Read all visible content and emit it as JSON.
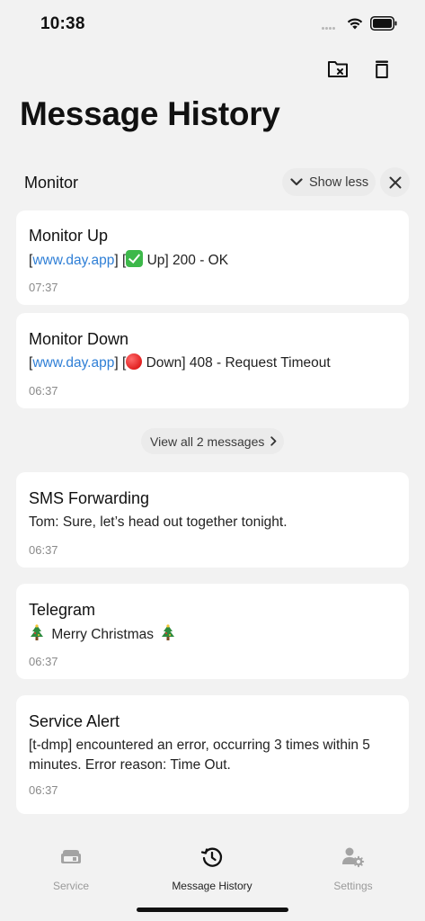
{
  "status_bar": {
    "time": "10:38"
  },
  "header": {
    "title": "Message History"
  },
  "group": {
    "name": "Monitor",
    "show_less_label": "Show less",
    "view_all_label": "View all 2 messages"
  },
  "messages": [
    {
      "title": "Monitor Up",
      "link": "www.day.app",
      "status": "Up] 200 - OK",
      "time": "07:37"
    },
    {
      "title": "Monitor Down",
      "link": "www.day.app",
      "status": "Down] 408 - Request Timeout",
      "time": "06:37"
    },
    {
      "title": "SMS Forwarding",
      "body": "Tom: Sure, let’s head out together tonight.",
      "time": "06:37"
    },
    {
      "title": "Telegram",
      "body": "Merry Christmas",
      "time": "06:37"
    },
    {
      "title": "Service Alert",
      "body": "[t-dmp] encountered an error, occurring 3 times within 5 minutes. Error reason: Time Out.",
      "time": "06:37"
    }
  ],
  "tabs": [
    {
      "label": "Service",
      "icon": "server-icon",
      "active": false
    },
    {
      "label": "Message History",
      "icon": "history-icon",
      "active": true
    },
    {
      "label": "Settings",
      "icon": "user-gear-icon",
      "active": false
    }
  ],
  "colors": {
    "link": "#2f7fd6",
    "background": "#f2f2f2",
    "card": "#ffffff"
  }
}
